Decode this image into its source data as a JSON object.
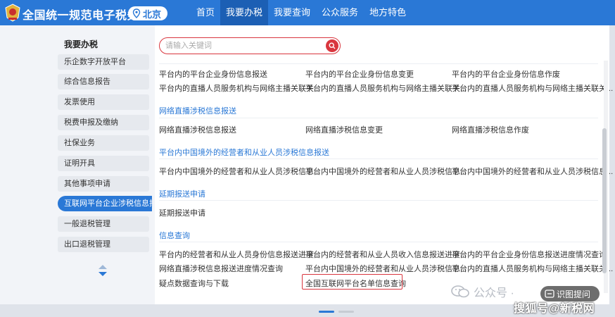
{
  "header": {
    "site_title": "全国统一规范电子税务局",
    "region": "北京",
    "nav": [
      "首页",
      "我要办税",
      "我要查询",
      "公众服务",
      "地方特色"
    ],
    "active_nav": 1
  },
  "sidebar": {
    "title": "我要办税",
    "items": [
      "乐企数字开放平台",
      "综合信息报告",
      "发票使用",
      "税费申报及缴纳",
      "社保业务",
      "证明开具",
      "其他事项申请",
      "互联网平台企业涉税信息报送",
      "一般退税管理",
      "出口退税管理"
    ],
    "active_index": 7
  },
  "search": {
    "placeholder": "请输入关键词"
  },
  "content": {
    "rows": [
      [
        "平台内的平台企业身份信息报送",
        "平台内的平台企业身份信息变更",
        "平台内的平台企业身份信息作废"
      ],
      [
        "平台内的直播人员服务机构与网络主播关联关...",
        "平台内的直播人员服务机构与网络主播关联关...",
        "平台内的直播人员服务机构与网络主播关联关..."
      ]
    ],
    "sections": [
      {
        "title": "网络直播涉税信息报送",
        "links": [
          "网络直播涉税信息报送",
          "网络直播涉税信息变更",
          "网络直播涉税信息作废"
        ]
      },
      {
        "title": "平台内中国境外的经营者和从业人员涉税信息报送",
        "links": [
          "平台内中国境外的经营者和从业人员涉税信息...",
          "平台内中国境外的经营者和从业人员涉税信息...",
          "平台内中国境外的经营者和从业人员涉税信息..."
        ]
      },
      {
        "title": "延期报送申请",
        "links": [
          "延期报送申请"
        ]
      },
      {
        "title": "信息查询",
        "links": [
          "平台内的经营者和从业人员身份信息报送进度...",
          "平台内的经营者和从业人员收入信息报送进度...",
          "平台内的平台企业身份信息报送进度情况查询",
          "网络直播涉税信息报送进度情况查询",
          "平台内中国境外的经营者和从业人员涉税信息...",
          "平台内的直播人员服务机构与网络主播关联关...",
          "疑点数据查询与下载",
          "全国互联网平台名单信息查询"
        ]
      }
    ]
  },
  "watermark": {
    "left": "公众号 · ",
    "badge": "识图提问",
    "bottom": "搜狐号@新税网"
  },
  "colors": {
    "header": "#2a78d6",
    "active_nav": "#1c5fb4",
    "highlight": "#d9363e"
  }
}
